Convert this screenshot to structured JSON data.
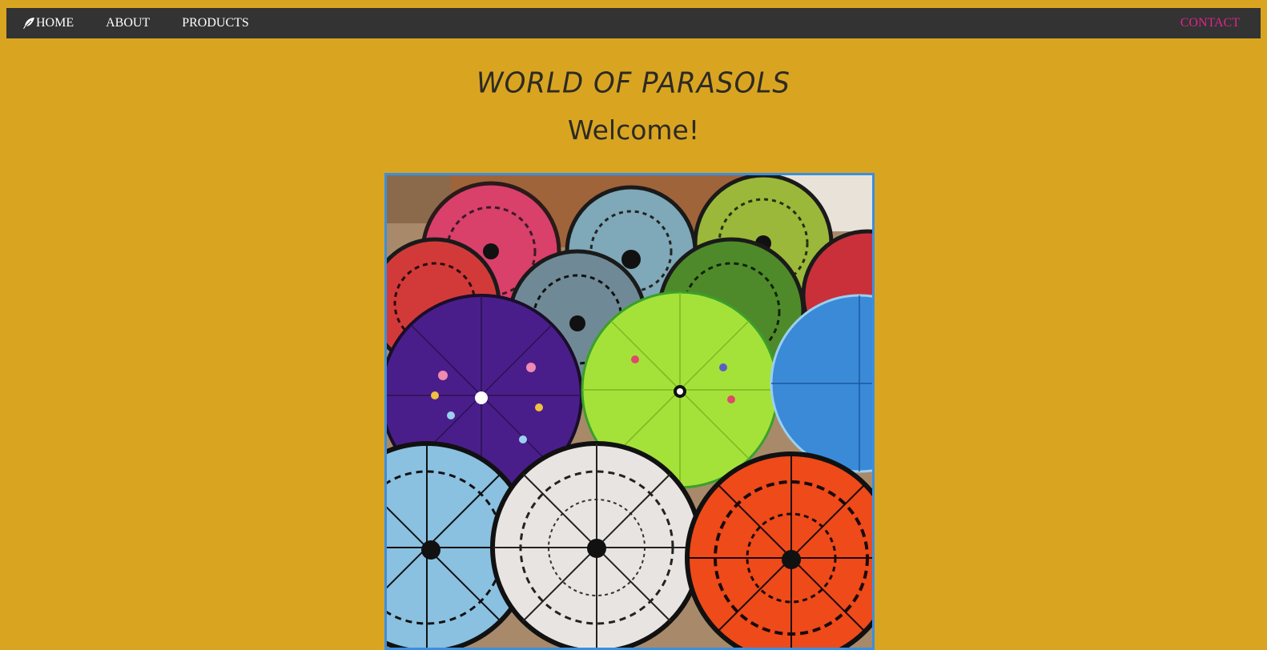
{
  "nav": {
    "home_label": "HOME",
    "about_label": "ABOUT",
    "products_label": "PRODUCTS",
    "contact_label": "CONTACT"
  },
  "header": {
    "title": "WORLD OF PARASOLS",
    "subtitle": "Welcome!"
  },
  "colors": {
    "page_background": "#d9a521",
    "navbar": "#333333",
    "nav_text": "#ffffff",
    "contact_accent": "#e0248c",
    "image_border": "#3a8fe0"
  },
  "hero_image": {
    "icon": "parasols-photo"
  }
}
